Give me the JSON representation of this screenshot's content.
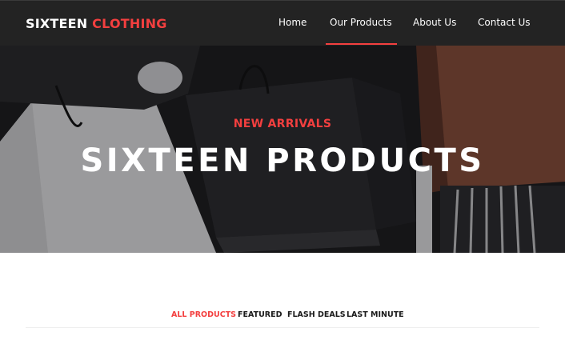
{
  "brand": {
    "name": "SIXTEEN",
    "accent": "CLOTHING"
  },
  "nav": {
    "items": [
      {
        "label": "Home",
        "active": false
      },
      {
        "label": "Our Products",
        "active": true
      },
      {
        "label": "About Us",
        "active": false
      },
      {
        "label": "Contact Us",
        "active": false
      }
    ]
  },
  "hero": {
    "subtitle": "NEW ARRIVALS",
    "title": "SIXTEEN PRODUCTS"
  },
  "filters": {
    "items": [
      {
        "label": "ALL PRODUCTS",
        "active": true
      },
      {
        "label": "FEATURED",
        "active": false
      },
      {
        "label": "FLASH DEALS",
        "active": false
      },
      {
        "label": "LAST MINUTE",
        "active": false
      }
    ]
  },
  "colors": {
    "accent": "#f33f3f",
    "navbar": "#232323",
    "text": "#1a1a1a"
  }
}
